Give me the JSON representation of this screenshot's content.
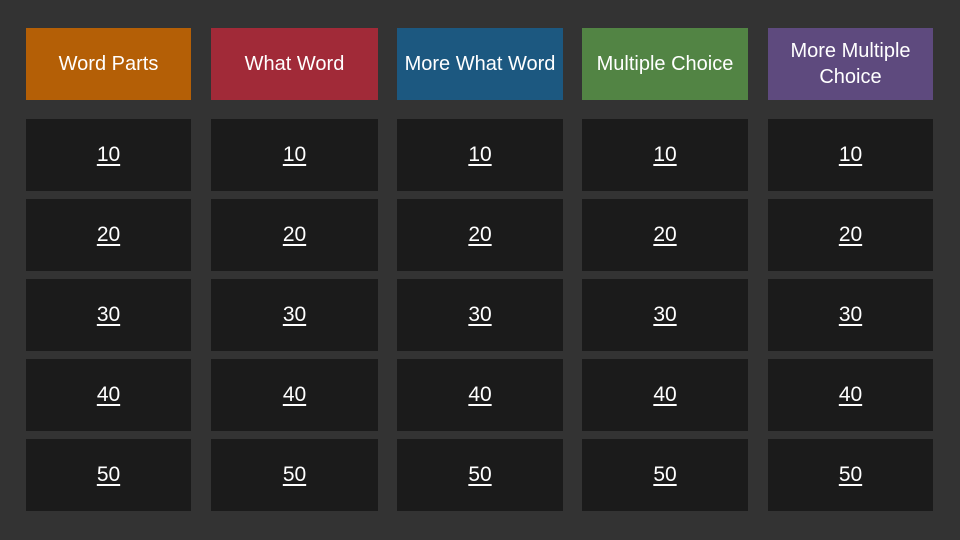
{
  "board": {
    "categories": [
      {
        "label": "Word Parts",
        "color": "#b45f06"
      },
      {
        "label": "What Word",
        "color": "#a12a38"
      },
      {
        "label": "More What Word",
        "color": "#1c5880"
      },
      {
        "label": "Multiple Choice",
        "color": "#528444"
      },
      {
        "label": "More Multiple Choice",
        "color": "#5e4a7e"
      }
    ],
    "values": [
      "10",
      "20",
      "30",
      "40",
      "50"
    ]
  },
  "colors": {
    "background": "#333333",
    "tile": "#1b1b1b",
    "text": "#ffffff"
  }
}
